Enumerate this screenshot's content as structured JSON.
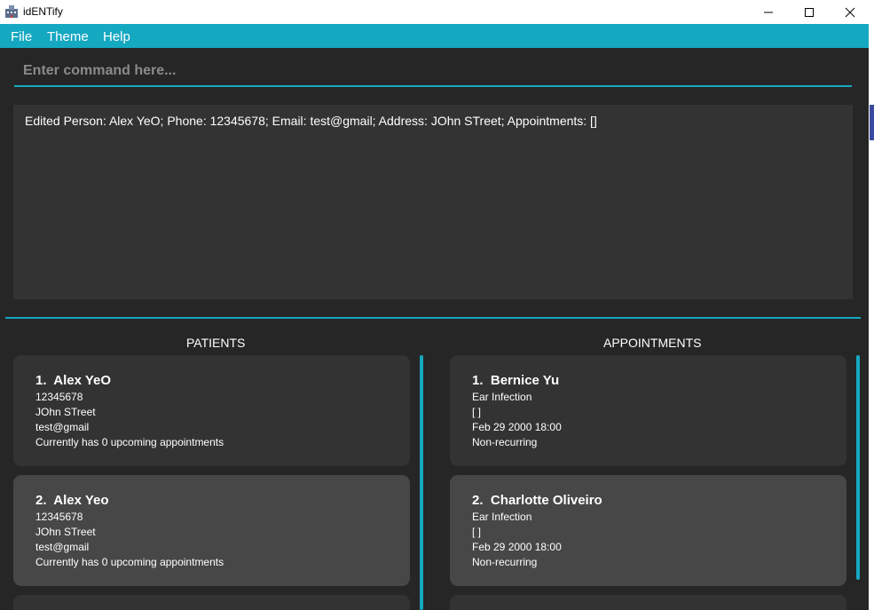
{
  "window": {
    "title": "idENTify"
  },
  "menu": [
    "File",
    "Theme",
    "Help"
  ],
  "command": {
    "placeholder": "Enter command here...",
    "value": ""
  },
  "result": {
    "text": "Edited Person: Alex YeO; Phone: 12345678; Email: test@gmail; Address: JOhn STreet; Appointments: []"
  },
  "patients": {
    "title": "PATIENTS",
    "items": [
      {
        "index": "1.",
        "name": "Alex YeO",
        "phone": "12345678",
        "address": "JOhn STreet",
        "email": "test@gmail",
        "appointments": "Currently has 0 upcoming appointments"
      },
      {
        "index": "2.",
        "name": "Alex Yeo",
        "phone": "12345678",
        "address": "JOhn STreet",
        "email": "test@gmail",
        "appointments": "Currently has 0 upcoming appointments"
      }
    ]
  },
  "appointments": {
    "title": "APPOINTMENTS",
    "items": [
      {
        "index": "1.",
        "name": "Bernice Yu",
        "reason": "Ear Infection",
        "tags": "[ ]",
        "datetime": "Feb 29 2000 18:00",
        "recurrence": "Non-recurring"
      },
      {
        "index": "2.",
        "name": "Charlotte Oliveiro",
        "reason": "Ear Infection",
        "tags": "[ ]",
        "datetime": "Feb 29 2000 18:00",
        "recurrence": "Non-recurring"
      }
    ]
  },
  "colors": {
    "accent": "#15a8c1",
    "background": "#262626",
    "card": "#333333",
    "card_selected": "#474747"
  }
}
